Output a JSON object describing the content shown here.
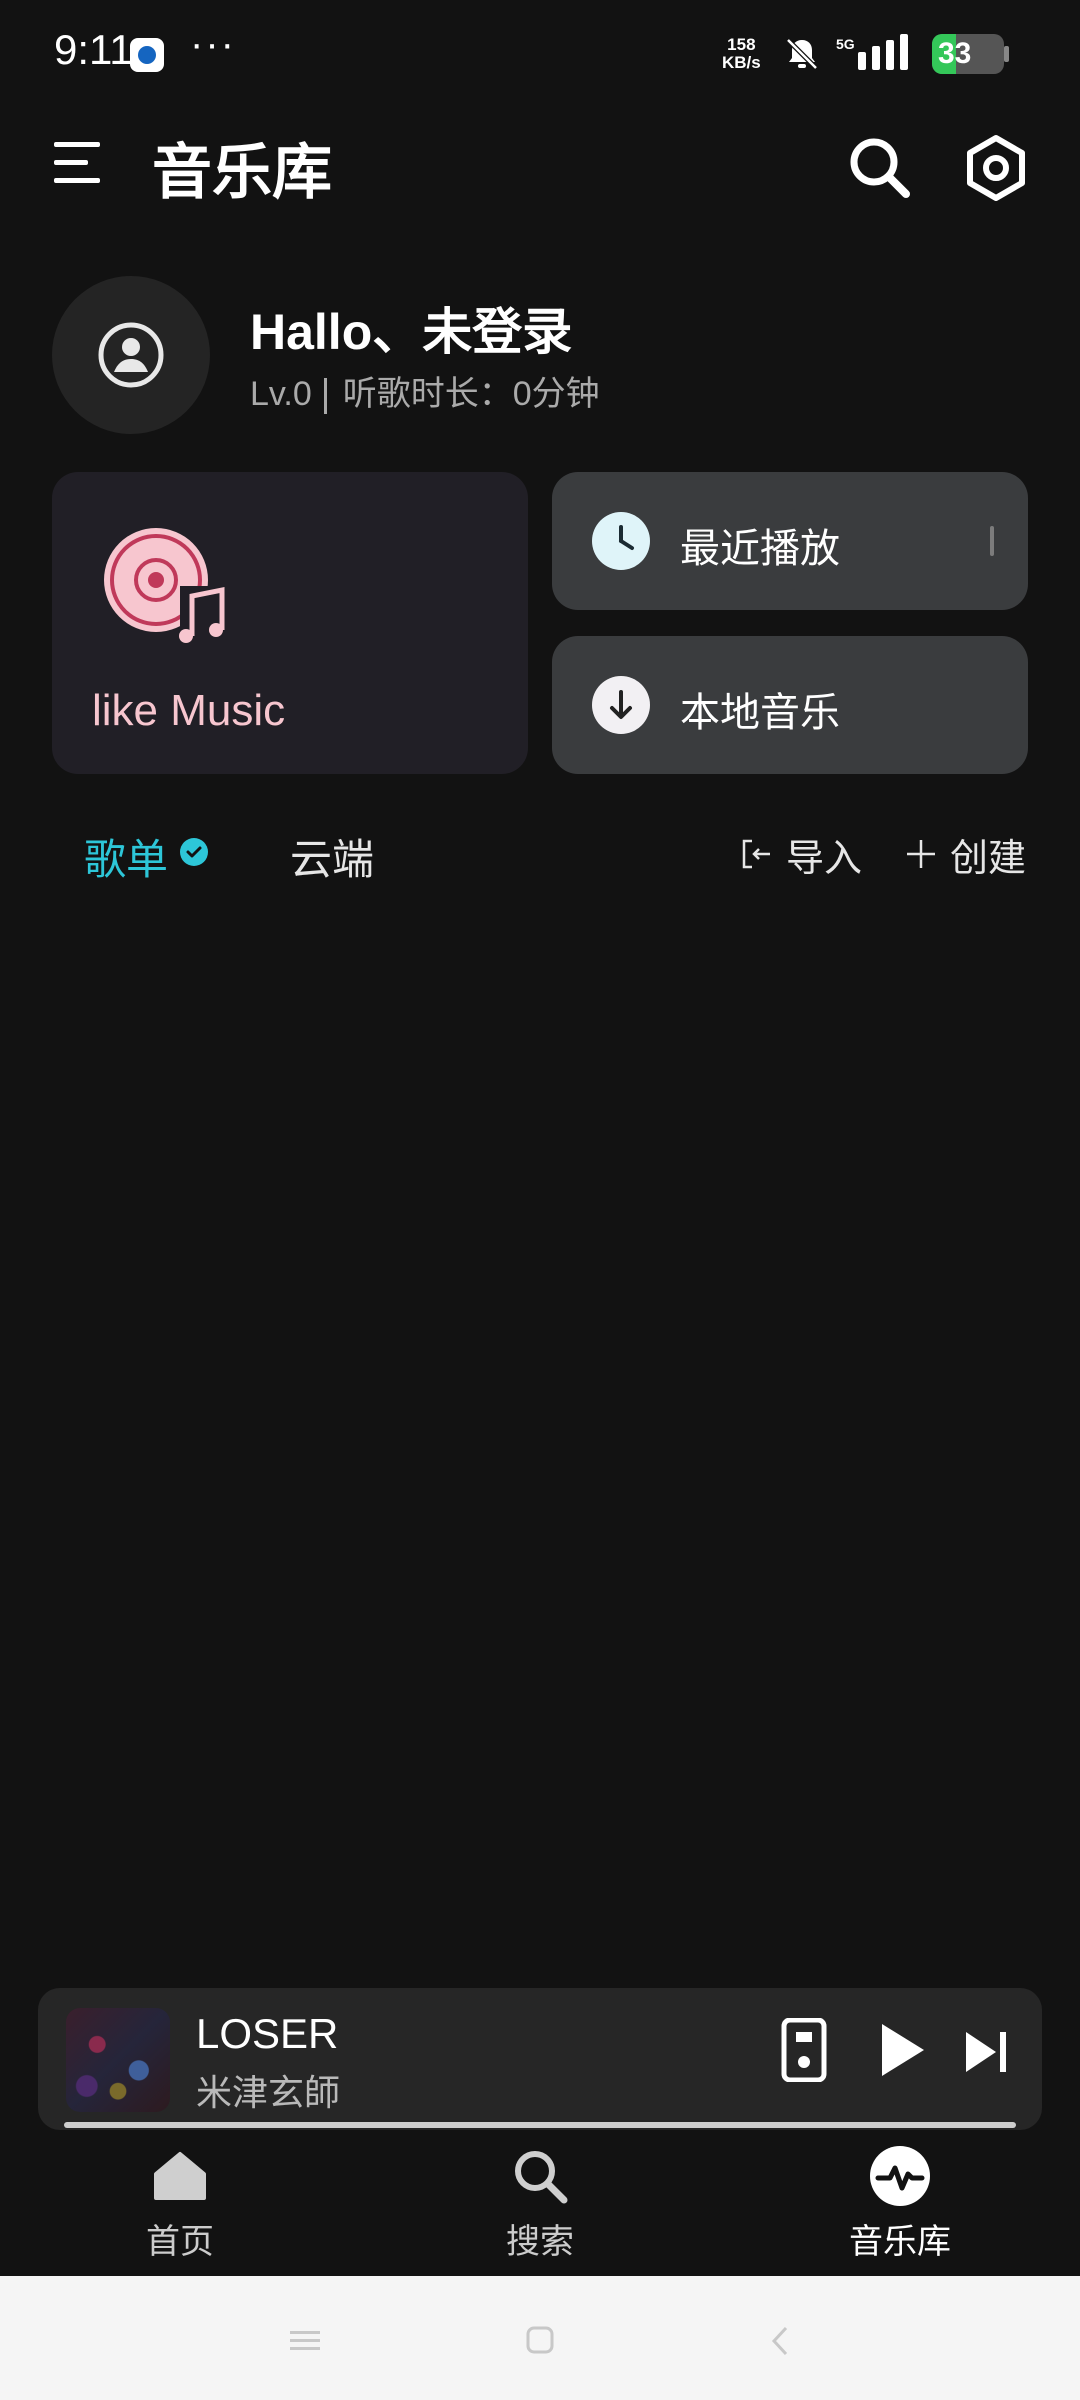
{
  "status_bar": {
    "time": "9:11",
    "more": "···",
    "net_speed_value": "158",
    "net_speed_unit": "KB/s",
    "network": "5G",
    "battery": "33",
    "battery_level": 0.33
  },
  "header": {
    "title": "音乐库"
  },
  "profile": {
    "greeting": "Hallo、未登录",
    "level": "Lv.0",
    "listen_time": "听歌时长：0分钟"
  },
  "cards": {
    "liked": "like Music",
    "recent": "最近播放",
    "local": "本地音乐"
  },
  "tabs": {
    "playlist": "歌单",
    "cloud": "云端",
    "import": "导入",
    "create": "创建"
  },
  "player": {
    "title": "LOSER",
    "artist": "米津玄師",
    "progress": 0.0
  },
  "bottom_nav": {
    "home": "首页",
    "search": "搜索",
    "library": "音乐库"
  },
  "colors": {
    "accent": "#2dc6d8",
    "liked_pink": "#f7c6cf",
    "background": "#121212"
  }
}
